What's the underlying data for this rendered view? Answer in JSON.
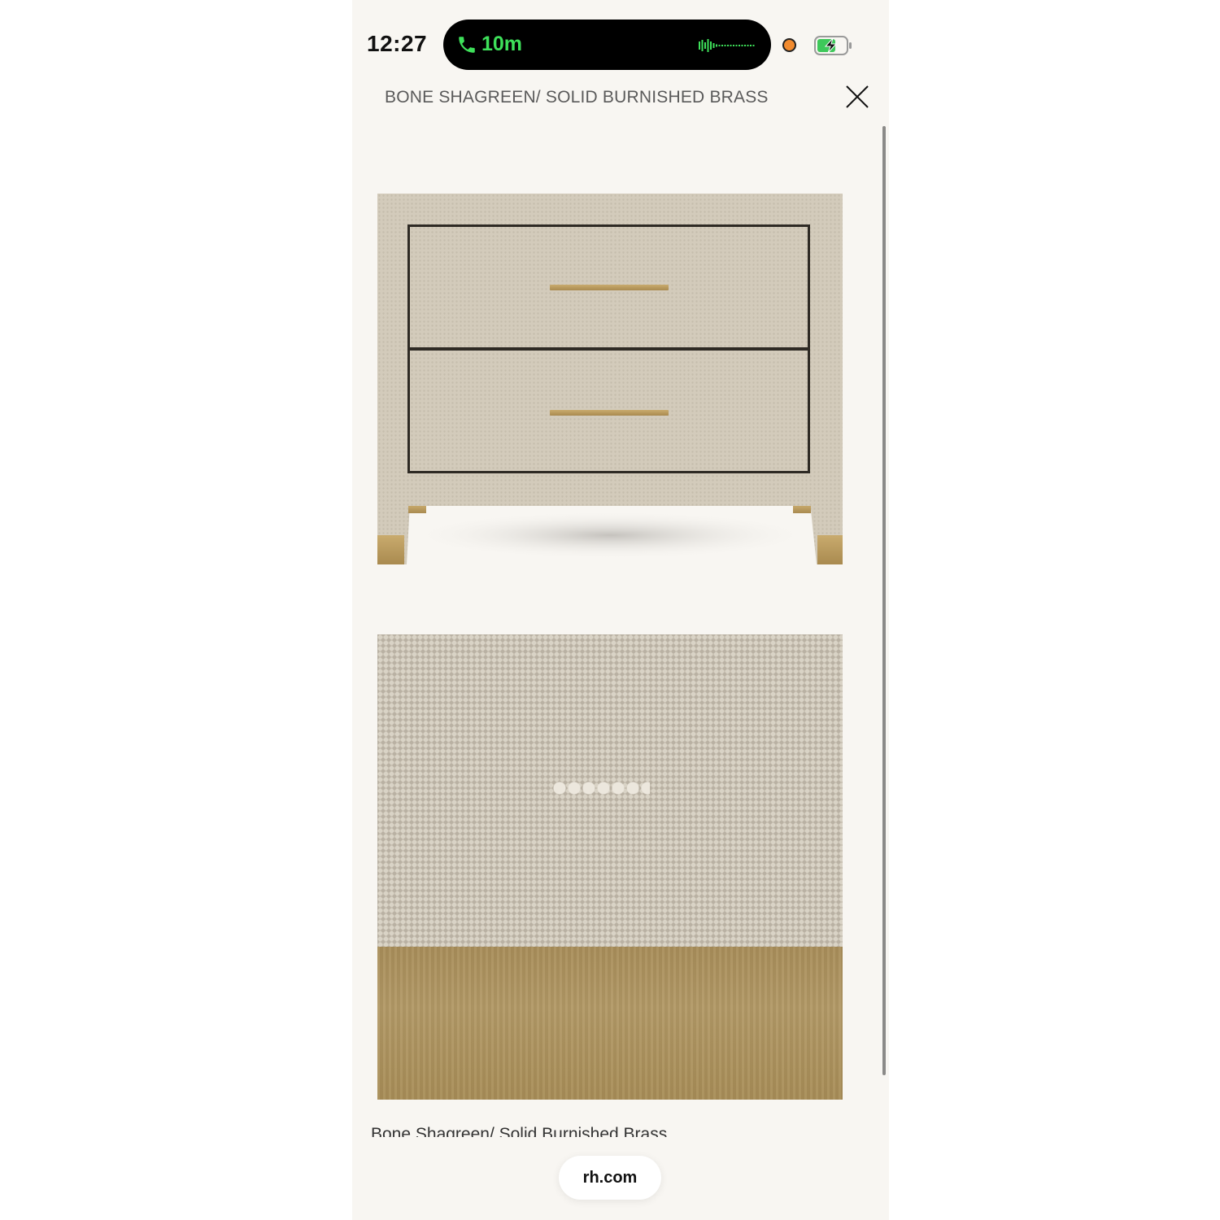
{
  "status_bar": {
    "time": "12:27",
    "call_duration": "10m",
    "call_accent": "#3ee05a",
    "recording_indicator_color": "#f28b2f",
    "battery_state": "charging"
  },
  "header": {
    "title": "BONE SHAGREEN/ SOLID BURNISHED BRASS",
    "close_icon": "close-icon"
  },
  "images": {
    "product": "nightstand-photo",
    "swatch": "finish-swatch-photo"
  },
  "caption": "Bone Shagreen/ Solid Burnished Brass",
  "browser": {
    "url": "rh.com"
  },
  "colors": {
    "background": "#f8f6f2",
    "shagreen": "#c9c2b4",
    "brass": "#b29966"
  }
}
